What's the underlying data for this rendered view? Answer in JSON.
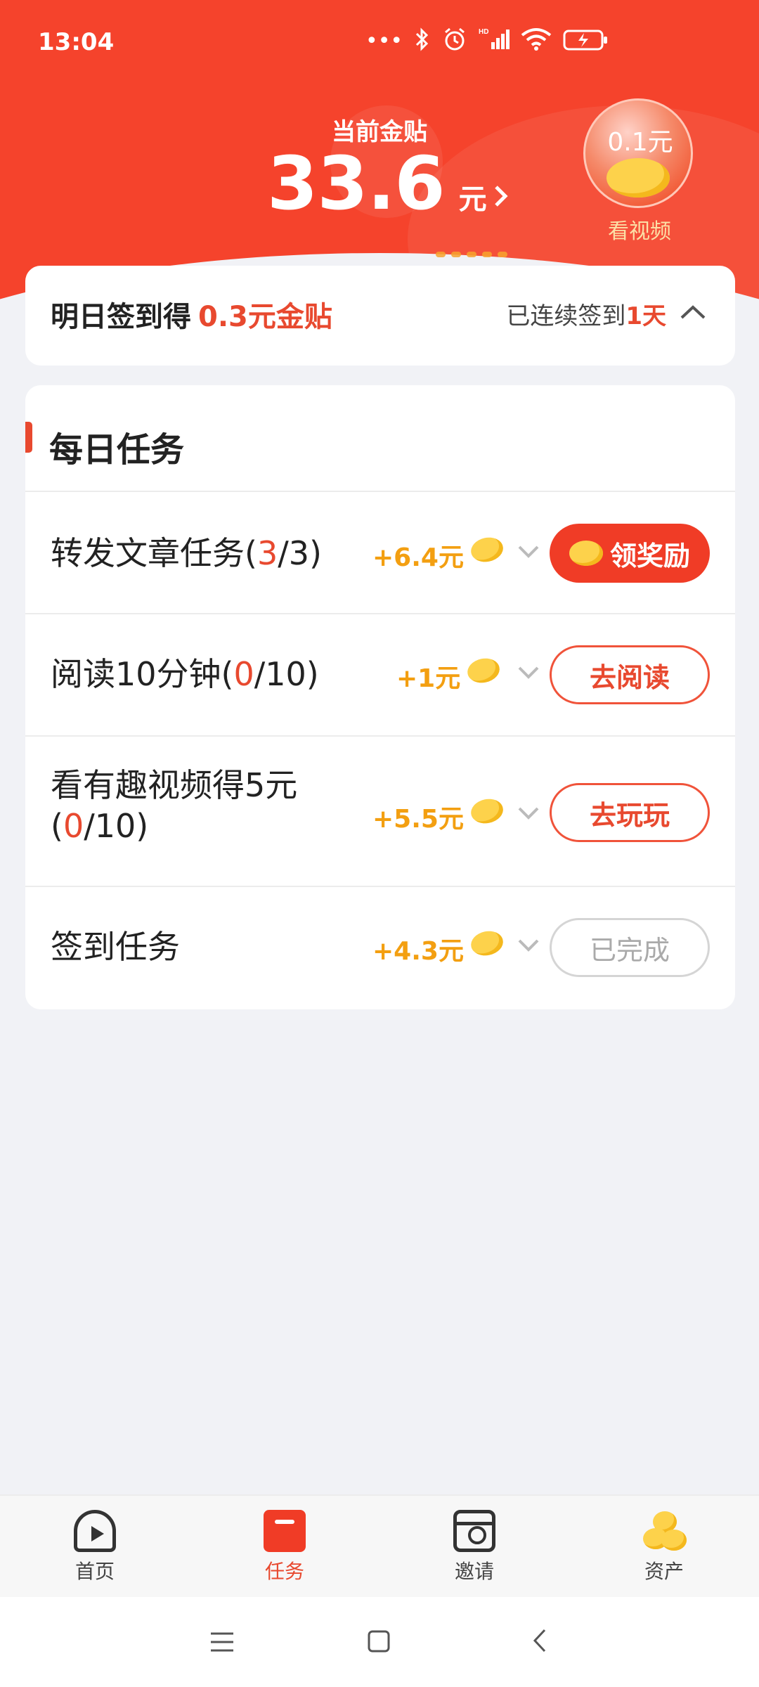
{
  "status_bar": {
    "time": "13:04",
    "icons": [
      "more-dots-icon",
      "bluetooth-icon",
      "alarm-icon",
      "hd-signal-icon",
      "wifi-icon",
      "battery-charging-icon"
    ]
  },
  "header": {
    "balance_label": "当前金贴",
    "balance_value": "33.6",
    "balance_unit": "元",
    "video_reward_amount": "0.1元",
    "video_reward_label": "看视频"
  },
  "signin": {
    "prefix": "明日签到得",
    "amount": "0.3元金贴",
    "streak_prefix": "已连续签到",
    "streak_days": "1天"
  },
  "tasks": {
    "title": "每日任务",
    "items": [
      {
        "name": "转发文章任务(",
        "current": "3",
        "total": "/3)",
        "reward": "+6.4元",
        "button": "领奖励",
        "state": "claim"
      },
      {
        "name": "阅读10分钟(",
        "current": "0",
        "total": "/10)",
        "reward": "+1元",
        "button": "去阅读",
        "state": "go"
      },
      {
        "name": "看有趣视频得5元(",
        "current": "0",
        "total": "/10)",
        "reward": "+5.5元",
        "button": "去玩玩",
        "state": "go"
      },
      {
        "name": "签到任务",
        "current": "",
        "total": "",
        "reward": "+4.3元",
        "button": "已完成",
        "state": "done"
      }
    ]
  },
  "bottom_nav": {
    "items": [
      {
        "label": "首页",
        "icon": "home-play-icon"
      },
      {
        "label": "任务",
        "icon": "task-bookmark-icon",
        "active": true
      },
      {
        "label": "邀请",
        "icon": "invite-icon"
      },
      {
        "label": "资产",
        "icon": "gold-coins-icon"
      }
    ]
  },
  "colors": {
    "primary_red": "#f5432c",
    "accent_orange": "#f39f11",
    "gold": "#fdd24b"
  }
}
